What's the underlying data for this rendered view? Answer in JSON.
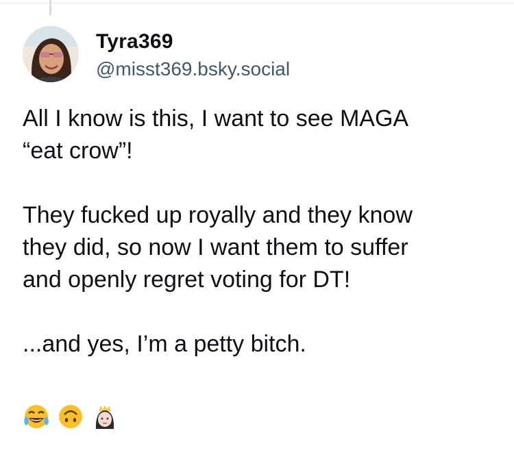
{
  "post": {
    "author": {
      "display_name": "Tyra369",
      "handle": "@misst369.bsky.social",
      "avatar_icon": "profile-photo"
    },
    "paragraphs": [
      "All I know is this, I want to see MAGA\n“eat crow”!",
      "They fucked up royally and they know\nthey did, so now I want them to suffer\nand openly regret voting for DT!",
      "...and yes, I’m a petty bitch."
    ],
    "emojis": [
      "face-with-tears-of-joy",
      "upside-down-face",
      "princess"
    ]
  }
}
